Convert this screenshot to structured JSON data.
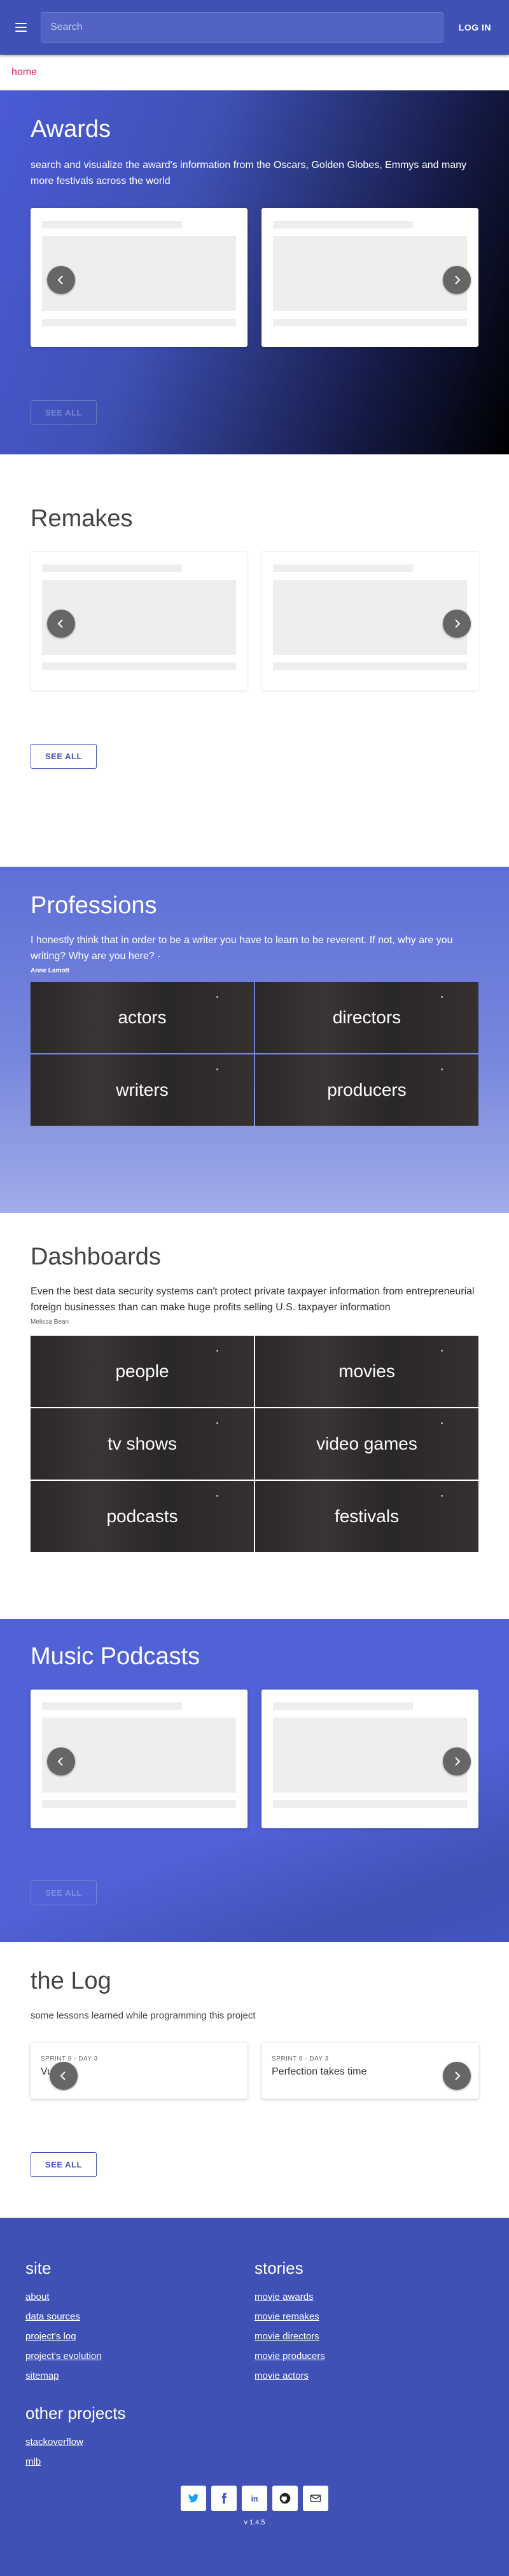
{
  "header": {
    "search_placeholder": "Search",
    "login_label": "LOG IN"
  },
  "breadcrumb": {
    "home": "home"
  },
  "awards": {
    "title": "Awards",
    "description": "search and visualize the award's information from the Oscars, Golden Globes, Emmys and many more festivals across the world",
    "see_all": "SEE ALL"
  },
  "remakes": {
    "title": "Remakes",
    "see_all": "SEE ALL"
  },
  "professions": {
    "title": "Professions",
    "quote": "I honestly think that in order to be a writer you have to learn to be reverent. If not, why are you writing? Why are you here? -",
    "author": "Anne Lamott",
    "tiles": [
      "actors",
      "directors",
      "writers",
      "producers"
    ]
  },
  "dashboards": {
    "title": "Dashboards",
    "quote": "Even the best data security systems can't protect private taxpayer information from entrepreneurial foreign businesses than can make huge profits selling U.S. taxpayer information",
    "author": "Melissa Bean",
    "tiles": [
      "people",
      "movies",
      "tv shows",
      "video games",
      "podcasts",
      "festivals"
    ]
  },
  "music": {
    "title": "Music Podcasts",
    "see_all": "SEE ALL"
  },
  "log": {
    "title": "the Log",
    "description": "some lessons learned while programming this project",
    "cards": [
      {
        "subtitle": "SPRINT 9 - DAY 3",
        "title": "Vue"
      },
      {
        "subtitle": "SPRINT 9 - DAY 3",
        "title": "Perfection takes time"
      }
    ],
    "see_all": "SEE ALL"
  },
  "footer": {
    "site_title": "site",
    "site_links": [
      "about",
      "data sources",
      "project's log",
      "project's evolution",
      "sitemap"
    ],
    "stories_title": "stories",
    "stories_links": [
      "movie awards",
      "movie remakes",
      "movie directors",
      "movie producers",
      "movie actors"
    ],
    "other_title": "other projects",
    "other_links": [
      "stackoverflow",
      "mlb"
    ],
    "social": [
      "twitter-icon",
      "facebook-icon",
      "linkedin-icon",
      "github-icon",
      "email-icon"
    ],
    "version": "v 1.4.5"
  },
  "colors": {
    "primary": "#3f51b5",
    "accent": "#e91e63",
    "tile": "#2b2828",
    "skeleton": "#eeeeee",
    "nav_button": "#666666"
  }
}
